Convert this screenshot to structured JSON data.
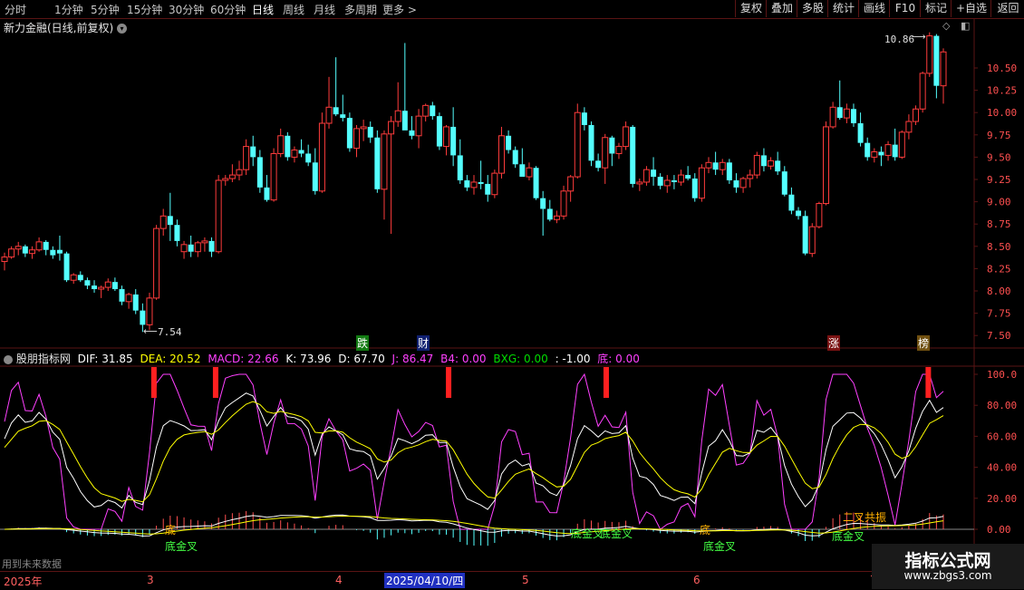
{
  "toolbar": {
    "periods": [
      "分时",
      "1分钟",
      "5分钟",
      "15分钟",
      "30分钟",
      "60分钟",
      "日线",
      "周线",
      "月线",
      "多周期",
      "更多 >"
    ],
    "active_period": "日线",
    "right_buttons": [
      "复权",
      "叠加",
      "多股",
      "统计",
      "画线",
      "F10",
      "标记",
      "+自选",
      "返回"
    ]
  },
  "main_chart": {
    "title": "新力金融(日线,前复权)",
    "high_label": "10.86",
    "low_label": "7.54",
    "y_ticks": [
      "10.50",
      "10.25",
      "10.00",
      "9.75",
      "9.50",
      "9.25",
      "9.00",
      "8.75",
      "8.50",
      "8.25",
      "8.00",
      "7.75",
      "7.50"
    ],
    "markers": [
      "跌",
      "财",
      "涨",
      "榜"
    ]
  },
  "indicator": {
    "name": "股朋指标网",
    "dif": "DIF: 31.85",
    "dea": "DEA: 20.52",
    "macd": "MACD: 22.66",
    "k": "K: 73.96",
    "d": "D: 67.70",
    "j": "J: 86.47",
    "b4": "B4: 0.00",
    "bxg": "BXG: 0.00",
    "neg": ": -1.00",
    "di": "底: 0.00",
    "y_ticks": [
      "100.0",
      "80.00",
      "60.00",
      "40.00",
      "20.00",
      "0.00"
    ],
    "texts": [
      "底",
      "底金叉",
      "底金叉",
      "底金叉",
      "底",
      "底金叉",
      "底金叉",
      "二叉共振"
    ],
    "bottom_note": "用到未来数据"
  },
  "date_axis": {
    "labels": [
      "2025年",
      "3",
      "4",
      "2025/04/10/四",
      "5",
      "6",
      "7"
    ]
  },
  "watermark": {
    "logo": "指标公式网",
    "url": "www.zbgs3.com"
  },
  "colors": {
    "up": "#ff3c3c",
    "down": "#54ffff",
    "grid": "#5a1414",
    "k_line": "#ffffff",
    "d_line": "#ffff00",
    "j_line": "#ff40ff"
  },
  "candles": [
    [
      8.33,
      8.43,
      8.23,
      8.38
    ],
    [
      8.38,
      8.5,
      8.36,
      8.47
    ],
    [
      8.47,
      8.55,
      8.4,
      8.5
    ],
    [
      8.5,
      8.52,
      8.38,
      8.42
    ],
    [
      8.42,
      8.5,
      8.36,
      8.46
    ],
    [
      8.46,
      8.6,
      8.44,
      8.55
    ],
    [
      8.55,
      8.57,
      8.4,
      8.46
    ],
    [
      8.46,
      8.5,
      8.36,
      8.4
    ],
    [
      8.46,
      8.62,
      8.34,
      8.42
    ],
    [
      8.42,
      8.44,
      8.1,
      8.12
    ],
    [
      8.12,
      8.2,
      8.08,
      8.18
    ],
    [
      8.18,
      8.22,
      8.1,
      8.12
    ],
    [
      8.12,
      8.15,
      8.02,
      8.06
    ],
    [
      8.06,
      8.12,
      7.98,
      8.02
    ],
    [
      8.02,
      8.06,
      7.92,
      8.04
    ],
    [
      8.04,
      8.14,
      8.0,
      8.1
    ],
    [
      8.1,
      8.15,
      8.0,
      8.02
    ],
    [
      8.02,
      8.06,
      7.84,
      7.88
    ],
    [
      7.88,
      7.98,
      7.8,
      7.96
    ],
    [
      7.96,
      8.02,
      7.74,
      7.78
    ],
    [
      7.78,
      7.86,
      7.54,
      7.62
    ],
    [
      7.62,
      7.98,
      7.56,
      7.92
    ],
    [
      7.92,
      8.74,
      7.9,
      8.7
    ],
    [
      8.7,
      8.92,
      8.62,
      8.84
    ],
    [
      8.84,
      9.1,
      8.56,
      8.74
    ],
    [
      8.74,
      8.8,
      8.5,
      8.56
    ],
    [
      8.44,
      8.56,
      8.36,
      8.52
    ],
    [
      8.52,
      8.62,
      8.38,
      8.44
    ],
    [
      8.44,
      8.56,
      8.38,
      8.54
    ],
    [
      8.54,
      8.6,
      8.44,
      8.56
    ],
    [
      8.56,
      8.6,
      8.38,
      8.44
    ],
    [
      8.44,
      9.3,
      8.42,
      9.24
    ],
    [
      9.24,
      9.3,
      9.18,
      9.26
    ],
    [
      9.26,
      9.42,
      9.22,
      9.3
    ],
    [
      9.3,
      9.46,
      9.24,
      9.36
    ],
    [
      9.36,
      9.7,
      9.3,
      9.62
    ],
    [
      9.62,
      9.74,
      9.4,
      9.5
    ],
    [
      9.5,
      9.58,
      9.1,
      9.16
    ],
    [
      9.16,
      9.3,
      9.0,
      9.02
    ],
    [
      9.02,
      9.6,
      9.0,
      9.54
    ],
    [
      9.54,
      9.82,
      9.5,
      9.74
    ],
    [
      9.74,
      9.78,
      9.46,
      9.5
    ],
    [
      9.5,
      9.62,
      9.44,
      9.58
    ],
    [
      9.58,
      9.7,
      9.5,
      9.54
    ],
    [
      9.54,
      9.64,
      9.4,
      9.44
    ],
    [
      9.44,
      9.6,
      9.08,
      9.12
    ],
    [
      9.12,
      10.0,
      9.1,
      9.88
    ],
    [
      9.88,
      10.4,
      9.82,
      10.06
    ],
    [
      10.06,
      10.62,
      9.96,
      9.98
    ],
    [
      9.98,
      10.2,
      9.9,
      9.94
    ],
    [
      9.94,
      10.0,
      9.56,
      9.6
    ],
    [
      9.6,
      9.86,
      9.5,
      9.82
    ],
    [
      9.82,
      9.92,
      9.68,
      9.84
    ],
    [
      9.84,
      9.9,
      9.66,
      9.72
    ],
    [
      9.72,
      9.8,
      9.1,
      9.14
    ],
    [
      9.14,
      9.8,
      8.8,
      9.76
    ],
    [
      9.76,
      9.96,
      8.64,
      9.9
    ],
    [
      9.9,
      10.34,
      9.84,
      10.02
    ],
    [
      10.02,
      10.78,
      9.82,
      9.8
    ],
    [
      9.8,
      9.96,
      9.7,
      9.74
    ],
    [
      9.74,
      10.04,
      9.6,
      9.96
    ],
    [
      9.96,
      10.1,
      9.9,
      10.08
    ],
    [
      10.08,
      10.12,
      9.92,
      9.96
    ],
    [
      9.96,
      10.0,
      9.58,
      9.62
    ],
    [
      9.62,
      9.86,
      9.52,
      9.84
    ],
    [
      9.84,
      10.06,
      9.4,
      9.52
    ],
    [
      9.52,
      9.7,
      9.2,
      9.24
    ],
    [
      9.24,
      9.3,
      9.12,
      9.16
    ],
    [
      9.16,
      9.3,
      9.08,
      9.22
    ],
    [
      9.22,
      9.46,
      9.14,
      9.2
    ],
    [
      9.2,
      9.3,
      9.0,
      9.08
    ],
    [
      9.08,
      9.36,
      9.04,
      9.32
    ],
    [
      9.32,
      9.84,
      9.26,
      9.74
    ],
    [
      9.74,
      9.8,
      9.54,
      9.58
    ],
    [
      9.58,
      9.62,
      9.38,
      9.42
    ],
    [
      9.42,
      9.6,
      9.36,
      9.28
    ],
    [
      9.28,
      9.44,
      9.24,
      9.38
    ],
    [
      9.38,
      9.4,
      9.02,
      9.04
    ],
    [
      9.04,
      9.12,
      8.62,
      8.92
    ],
    [
      8.92,
      9.02,
      8.78,
      8.8
    ],
    [
      8.8,
      8.9,
      8.76,
      8.84
    ],
    [
      8.84,
      9.18,
      8.8,
      9.12
    ],
    [
      9.12,
      9.3,
      9.0,
      9.28
    ],
    [
      9.28,
      10.1,
      9.26,
      10.0
    ],
    [
      10.0,
      10.06,
      9.8,
      9.86
    ],
    [
      9.86,
      9.9,
      9.4,
      9.46
    ],
    [
      9.46,
      9.54,
      9.34,
      9.38
    ],
    [
      9.38,
      9.76,
      9.2,
      9.72
    ],
    [
      9.72,
      9.74,
      9.4,
      9.54
    ],
    [
      9.54,
      9.66,
      9.48,
      9.62
    ],
    [
      9.62,
      9.9,
      9.58,
      9.84
    ],
    [
      9.84,
      9.86,
      9.16,
      9.2
    ],
    [
      9.2,
      9.26,
      9.12,
      9.22
    ],
    [
      9.22,
      9.4,
      9.18,
      9.36
    ],
    [
      9.36,
      9.5,
      9.18,
      9.28
    ],
    [
      9.28,
      9.32,
      9.14,
      9.18
    ],
    [
      9.18,
      9.3,
      9.1,
      9.24
    ],
    [
      9.24,
      9.3,
      9.14,
      9.22
    ],
    [
      9.22,
      9.36,
      9.18,
      9.3
    ],
    [
      9.3,
      9.4,
      9.24,
      9.26
    ],
    [
      9.26,
      9.32,
      9.0,
      9.04
    ],
    [
      9.04,
      9.42,
      9.0,
      9.38
    ],
    [
      9.38,
      9.5,
      9.32,
      9.44
    ],
    [
      9.44,
      9.56,
      9.3,
      9.36
    ],
    [
      9.36,
      9.48,
      9.3,
      9.44
    ],
    [
      9.44,
      9.48,
      9.2,
      9.24
    ],
    [
      9.24,
      9.32,
      9.1,
      9.16
    ],
    [
      9.16,
      9.28,
      9.1,
      9.26
    ],
    [
      9.26,
      9.36,
      9.16,
      9.3
    ],
    [
      9.3,
      9.56,
      9.26,
      9.52
    ],
    [
      9.52,
      9.6,
      9.34,
      9.4
    ],
    [
      9.4,
      9.5,
      9.36,
      9.46
    ],
    [
      9.46,
      9.56,
      9.3,
      9.34
    ],
    [
      9.34,
      9.4,
      9.06,
      9.08
    ],
    [
      9.08,
      9.16,
      8.86,
      8.9
    ],
    [
      8.9,
      8.94,
      8.8,
      8.84
    ],
    [
      8.84,
      8.9,
      8.4,
      8.42
    ],
    [
      8.42,
      8.76,
      8.38,
      8.72
    ],
    [
      8.72,
      9.0,
      8.7,
      8.98
    ],
    [
      8.98,
      9.9,
      8.96,
      9.84
    ],
    [
      9.84,
      10.12,
      9.82,
      10.06
    ],
    [
      10.06,
      10.36,
      9.92,
      9.94
    ],
    [
      9.94,
      10.1,
      9.88,
      10.04
    ],
    [
      10.04,
      10.1,
      9.84,
      9.88
    ],
    [
      9.88,
      10.0,
      9.62,
      9.66
    ],
    [
      9.66,
      9.72,
      9.46,
      9.5
    ],
    [
      9.5,
      9.6,
      9.44,
      9.56
    ],
    [
      9.56,
      9.62,
      9.4,
      9.52
    ],
    [
      9.52,
      9.68,
      9.46,
      9.64
    ],
    [
      9.64,
      9.82,
      9.46,
      9.5
    ],
    [
      9.5,
      9.8,
      9.48,
      9.78
    ],
    [
      9.78,
      9.98,
      9.7,
      9.9
    ],
    [
      9.9,
      10.08,
      9.86,
      10.04
    ],
    [
      10.04,
      10.46,
      10.0,
      10.44
    ],
    [
      10.44,
      10.9,
      10.4,
      10.86
    ],
    [
      10.86,
      10.88,
      10.16,
      10.3
    ],
    [
      10.3,
      10.72,
      10.1,
      10.68
    ]
  ]
}
